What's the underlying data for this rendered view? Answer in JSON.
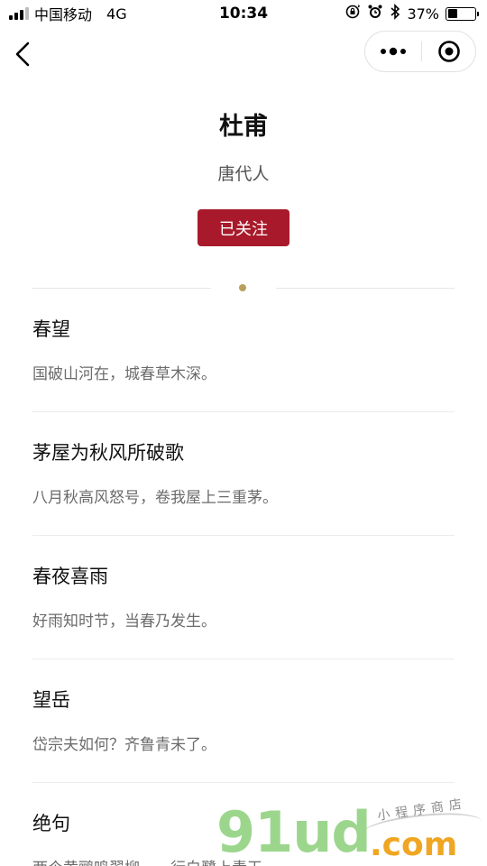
{
  "status_bar": {
    "carrier": "中国移动",
    "network": "4G",
    "time": "10:34",
    "battery_percent": "37%",
    "battery_level": 0.37
  },
  "nav": {
    "back_icon": "chevron-left-icon",
    "more_icon": "more-dots-icon",
    "close_icon": "target-close-icon"
  },
  "poet": {
    "name": "杜甫",
    "era": "唐代人",
    "follow_label": "已关注"
  },
  "colors": {
    "follow_button": "#a81a2b",
    "divider_dot": "#b99f5c",
    "watermark_green": "#8bd07a",
    "watermark_orange": "#f0a623"
  },
  "poems": [
    {
      "title": "春望",
      "first_line": "国破山河在，城春草木深。"
    },
    {
      "title": "茅屋为秋风所破歌",
      "first_line": "八月秋高风怒号，卷我屋上三重茅。"
    },
    {
      "title": "春夜喜雨",
      "first_line": "好雨知时节，当春乃发生。"
    },
    {
      "title": "望岳",
      "first_line": "岱宗夫如何？齐鲁青未了。"
    },
    {
      "title": "绝句",
      "first_line": "两个黄鹂鸣翠柳，一行白鹭上青天。"
    }
  ],
  "watermark": {
    "brand": "91ud",
    "domain": ".com",
    "subtitle": "小程序商店"
  }
}
